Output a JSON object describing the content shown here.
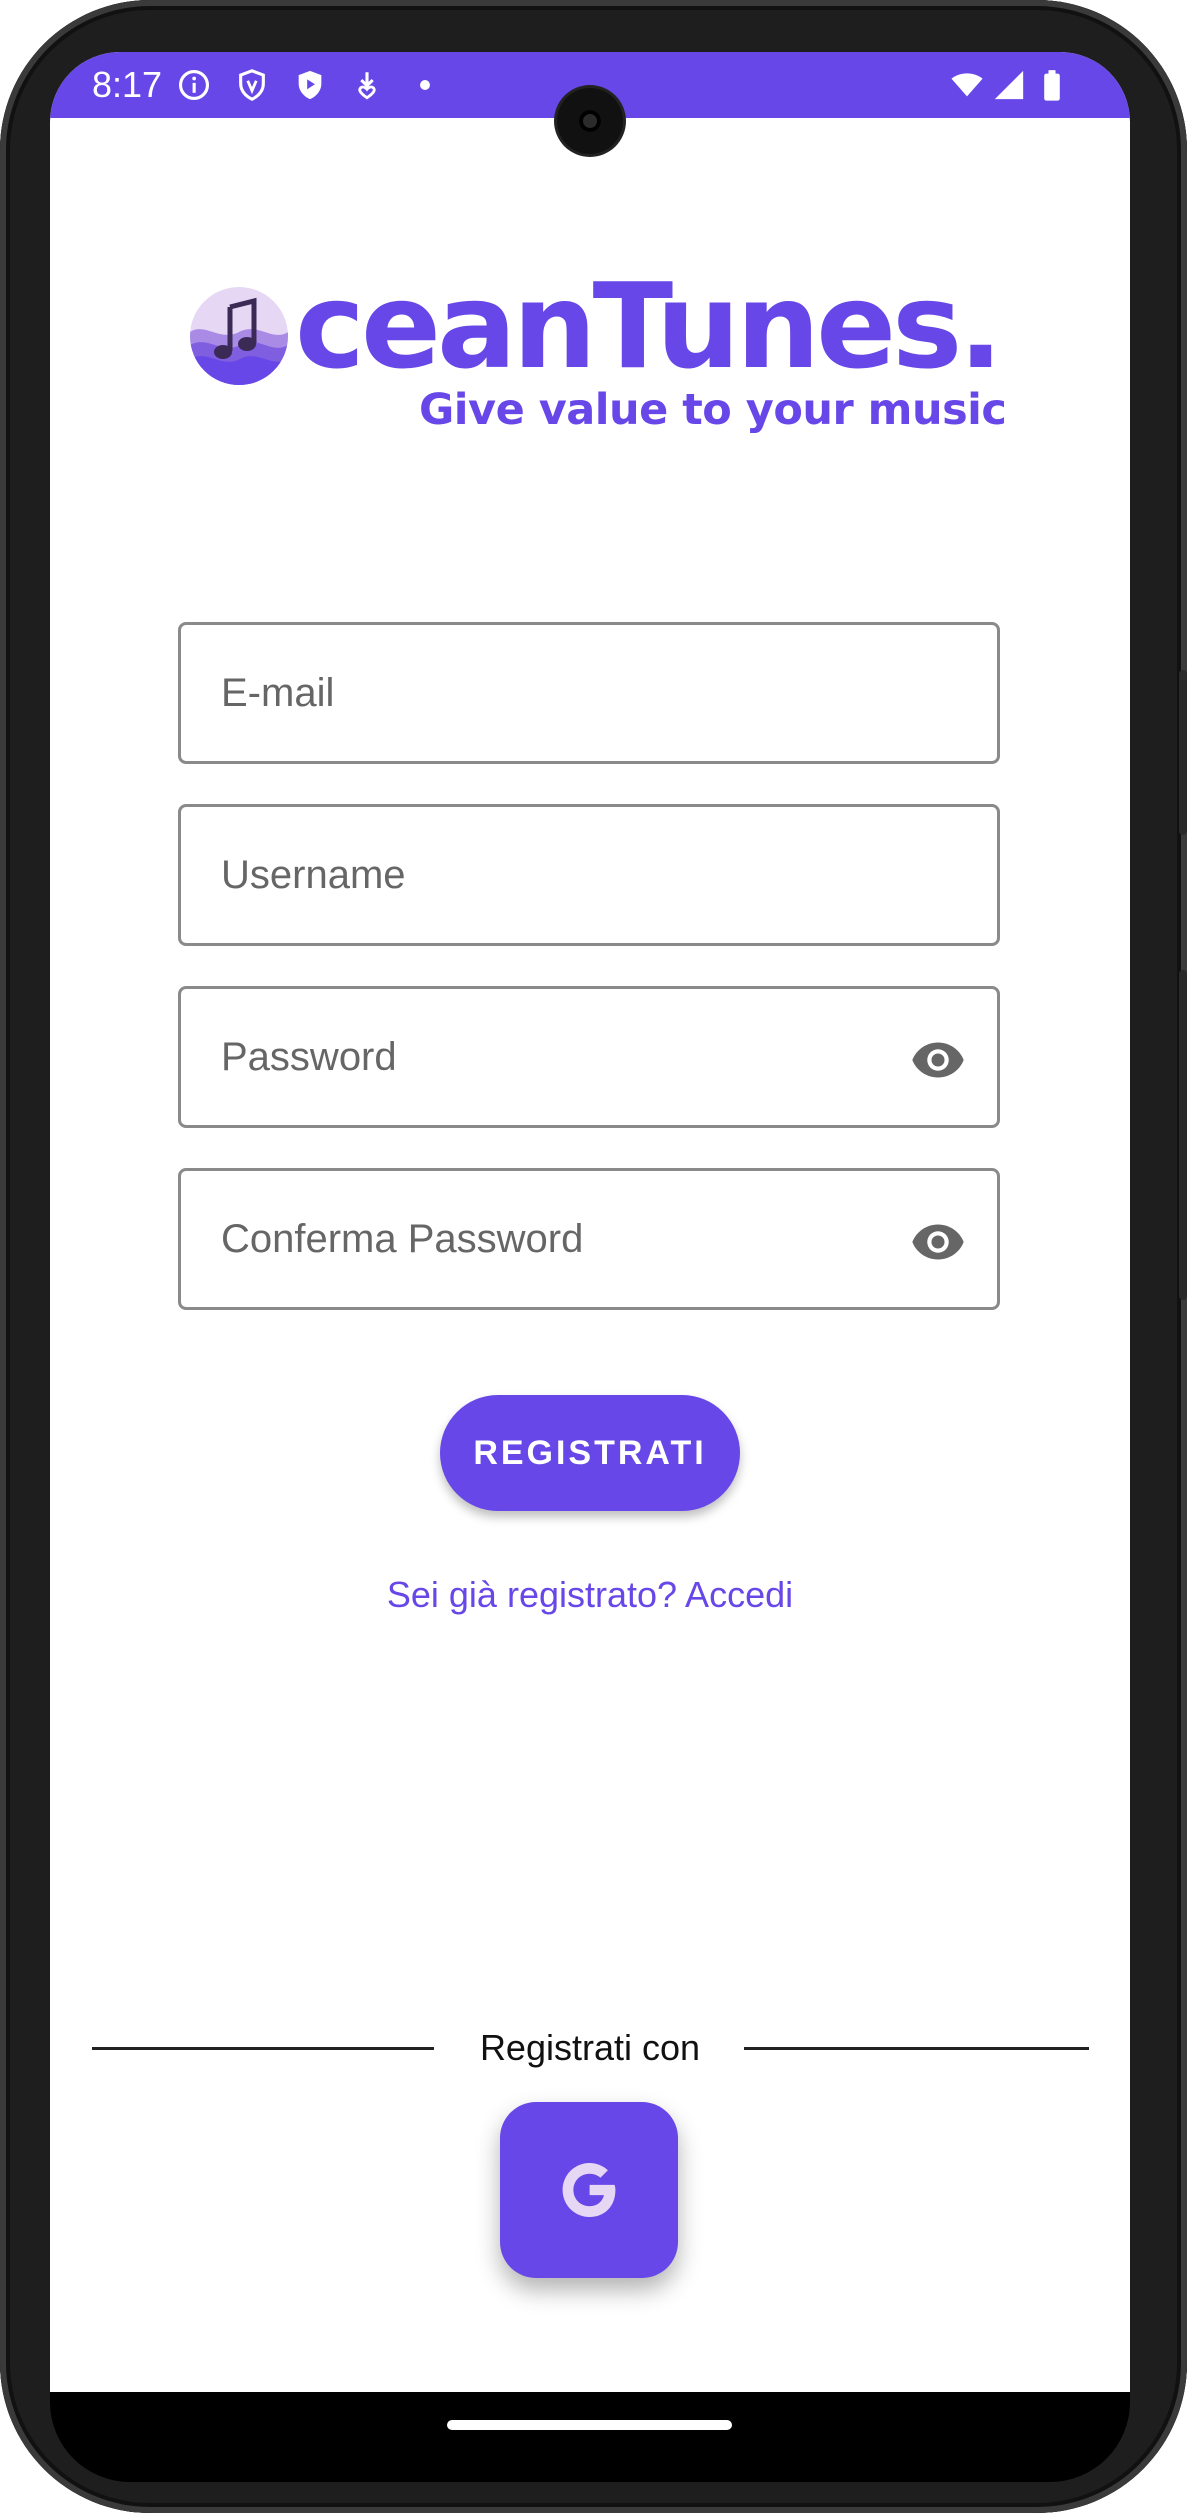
{
  "status_bar": {
    "time": "8:17",
    "icons_left": [
      "info-icon",
      "shield-outline-icon",
      "shield-play-icon",
      "download-heart-icon",
      "dot-icon"
    ],
    "icons_right": [
      "wifi-icon",
      "signal-icon",
      "battery-icon"
    ],
    "background": "#6847e8"
  },
  "logo": {
    "wordmark": "ceanTunes.",
    "tagline": "Give value to your music",
    "brand_color": "#6847e8"
  },
  "form": {
    "email_placeholder": "E-mail",
    "username_placeholder": "Username",
    "password_placeholder": "Password",
    "confirm_password_placeholder": "Conferma Password"
  },
  "actions": {
    "register_label": "REGISTRATI",
    "login_link": "Sei già registrato? Accedi"
  },
  "social": {
    "divider_label": "Registrati con",
    "google_icon": "google-g-icon"
  },
  "colors": {
    "accent": "#6847e8",
    "field_border": "#8a8a8a",
    "icon_grey": "#666666"
  }
}
